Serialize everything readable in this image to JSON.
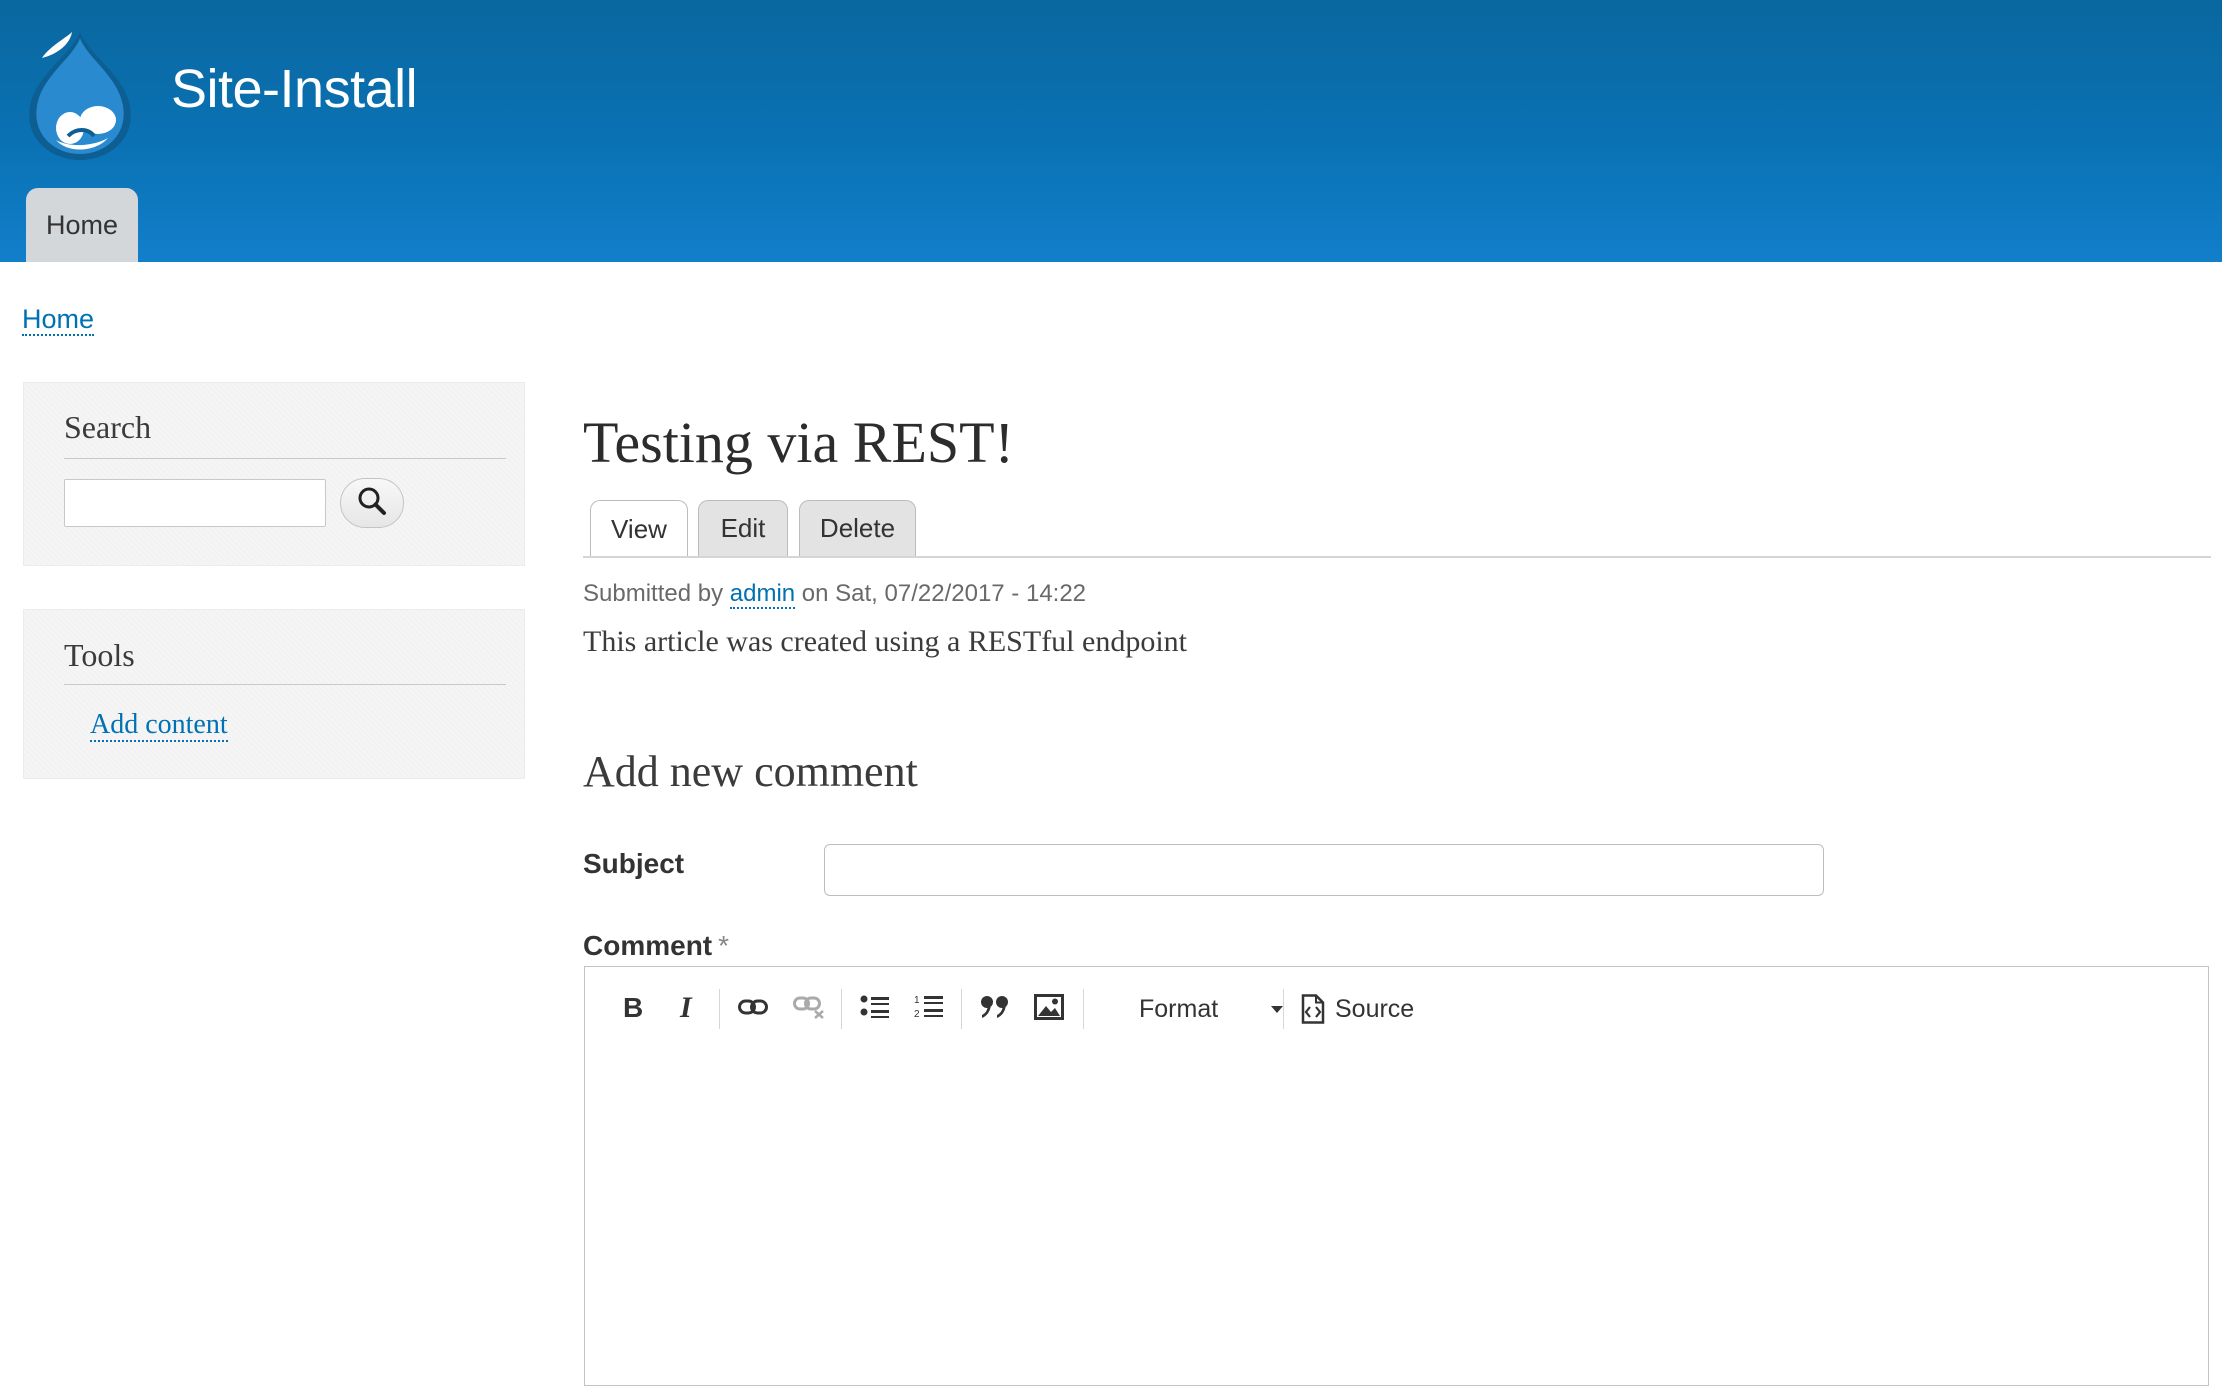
{
  "header": {
    "site_name": "Site-Install",
    "nav": {
      "home_label": "Home"
    }
  },
  "breadcrumb": {
    "home_label": "Home"
  },
  "sidebar": {
    "search": {
      "title": "Search",
      "input_value": ""
    },
    "tools": {
      "title": "Tools",
      "links": [
        {
          "label": "Add content"
        }
      ]
    }
  },
  "article": {
    "title": "Testing via REST!",
    "tabs": [
      {
        "label": "View",
        "active": true
      },
      {
        "label": "Edit",
        "active": false
      },
      {
        "label": "Delete",
        "active": false
      }
    ],
    "meta": {
      "prefix": "Submitted by",
      "author": "admin",
      "suffix": "on Sat, 07/22/2017 - 14:22"
    },
    "body": "This article was created using a RESTful endpoint"
  },
  "comment_form": {
    "heading": "Add new comment",
    "subject_label": "Subject",
    "subject_value": "",
    "comment_label": "Comment",
    "required_marker": "*",
    "toolbar": {
      "buttons": [
        "bold-icon",
        "italic-icon",
        "link-icon",
        "unlink-icon",
        "bulleted-list-icon",
        "numbered-list-icon",
        "blockquote-icon",
        "image-icon"
      ],
      "format_label": "Format",
      "source_label": "Source"
    },
    "editor_value": ""
  },
  "colors": {
    "header_top": "#0a679f",
    "header_bottom": "#127fcb",
    "link": "#0071b3"
  }
}
